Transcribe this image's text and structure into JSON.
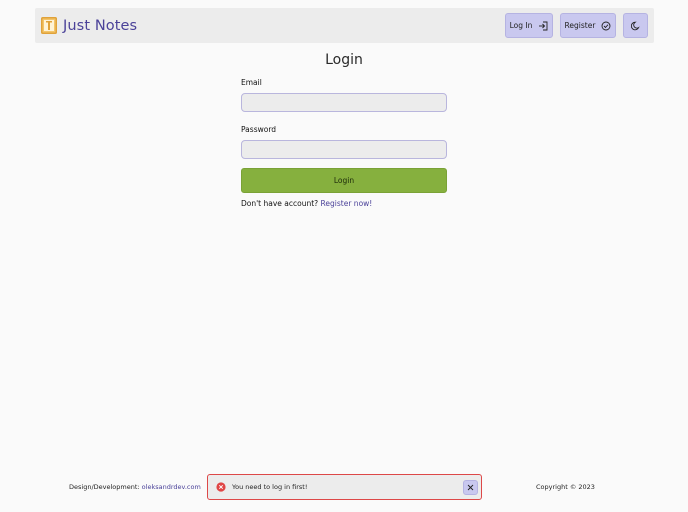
{
  "header": {
    "brand": "Just Notes",
    "login_label": "Log In",
    "register_label": "Register",
    "logo_icon": "notebook-icon",
    "theme_icon": "moon-icon"
  },
  "page": {
    "title": "Login"
  },
  "form": {
    "email_label": "Email",
    "email_value": "",
    "password_label": "Password",
    "password_value": "",
    "submit_label": "Login",
    "no_account_text": "Don't have account?",
    "register_link": "Register now!"
  },
  "footer": {
    "credit_prefix": "Design/Development:",
    "credit_link": "oleksandrdev.com",
    "copyright": "Copyright © 2023"
  },
  "toast": {
    "message": "You need to log in first!",
    "status_color": "#dd4848"
  },
  "colors": {
    "accent": "#4b4299",
    "nav_button": "#c9c8ef",
    "submit": "#86b03e"
  }
}
